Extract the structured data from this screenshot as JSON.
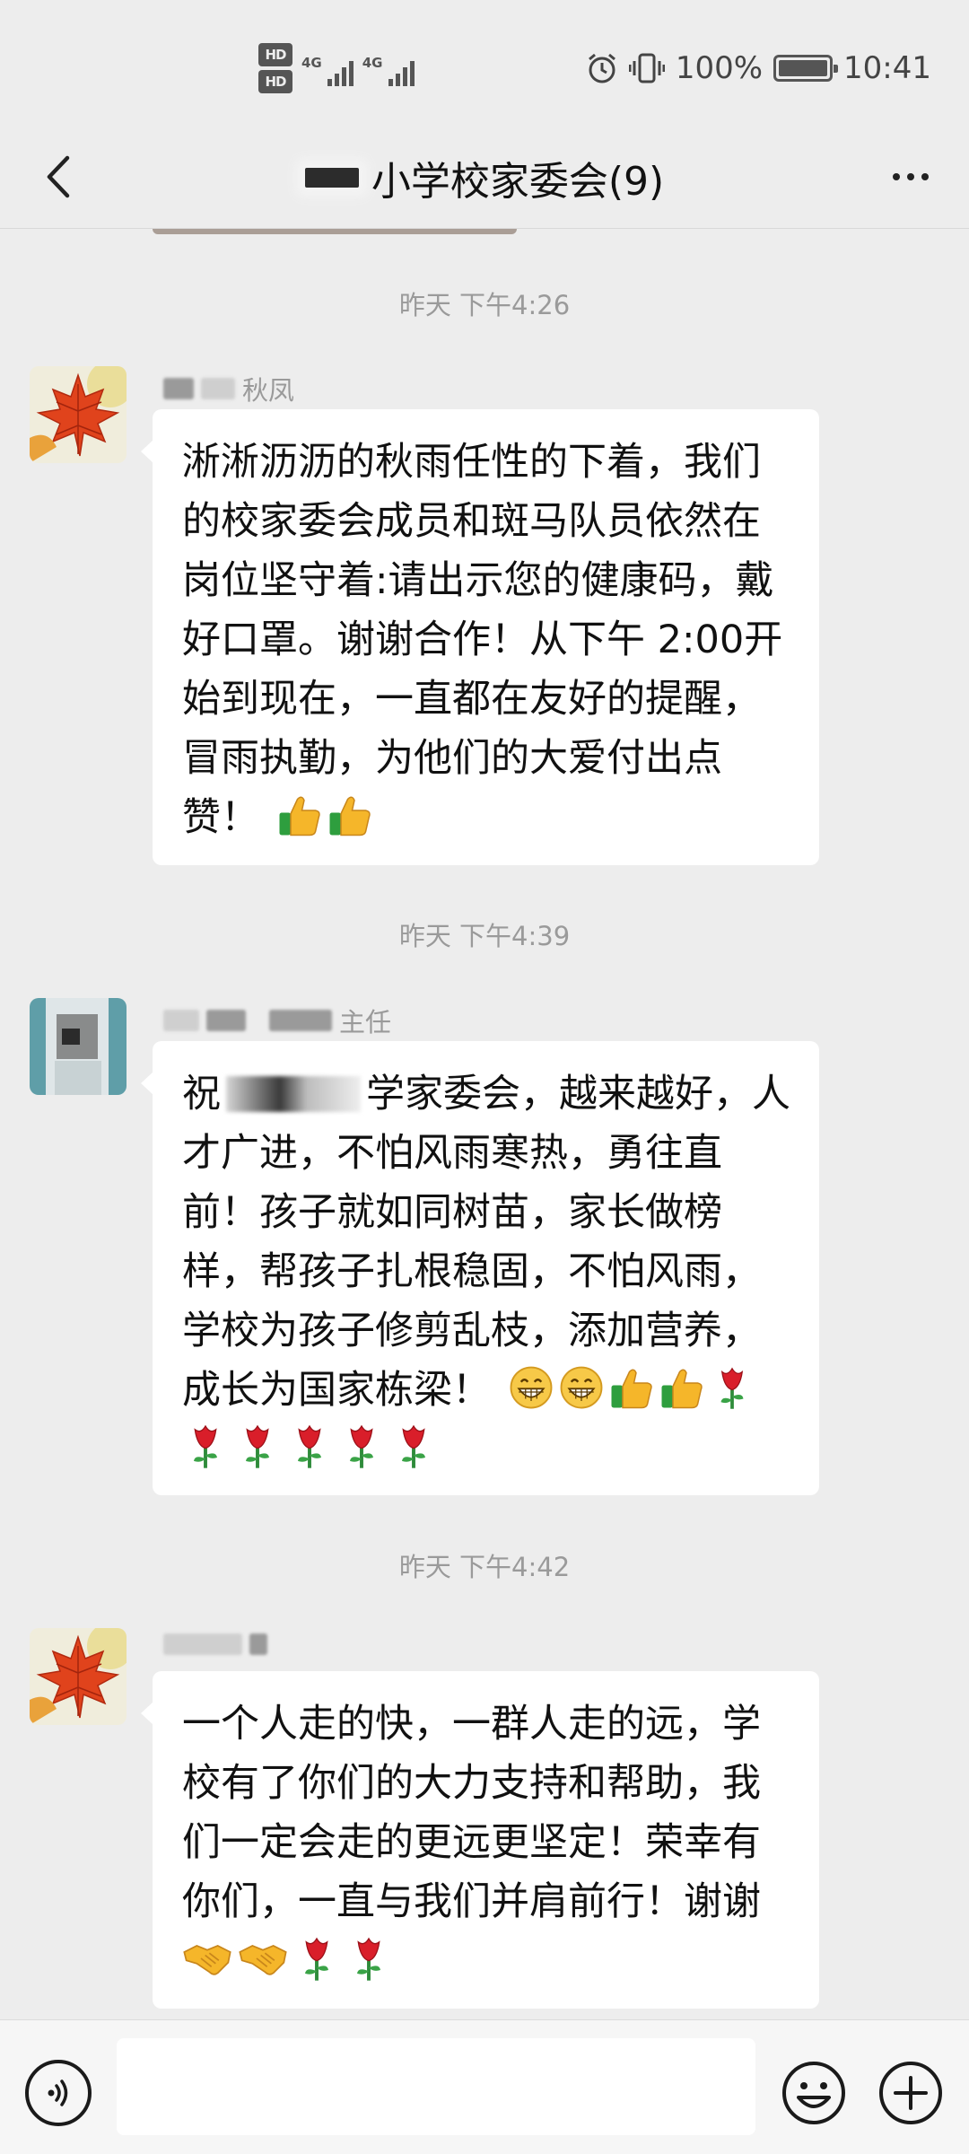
{
  "status_bar": {
    "hd1": "HD",
    "hd2": "HD",
    "net1": "4G",
    "net2": "4G",
    "battery_percent_text": "100%",
    "battery_level": 1.0,
    "time": "10:41",
    "icons": [
      "alarm-icon",
      "vibrate-icon",
      "battery-icon"
    ]
  },
  "header": {
    "title": "小学校家委会(9)",
    "back_icon": "chevron-left-icon",
    "more_icon": "more-icon"
  },
  "messages": [
    {
      "timestamp": "昨天 下午4:26",
      "sender_visible": "秋凤",
      "avatar": "maple-leaf-avatar",
      "text": "淅淅沥沥的秋雨任性的下着，我们的校家委会成员和斑马队员依然在岗位坚守着:请出示您的健康码，戴好口罩。谢谢合作！从下午 2:00开始到现在，一直都在友好的提醒，冒雨执勤，为他们的大爱付出点赞！",
      "emojis": [
        "thumbs-up",
        "thumbs-up"
      ]
    },
    {
      "timestamp": "昨天 下午4:39",
      "sender_visible": "主任",
      "avatar": "portrait-avatar",
      "text_prefix": "祝",
      "text": "学家委会，越来越好，人才广进，不怕风雨寒热，勇往直前！孩子就如同树苗，家长做榜样，帮孩子扎根稳固，不怕风雨，学校为孩子修剪乱枝，添加营养，成长为国家栋梁！",
      "emojis": [
        "grin",
        "grin",
        "thumbs-up",
        "thumbs-up",
        "rose",
        "rose",
        "rose",
        "rose",
        "rose",
        "rose"
      ]
    },
    {
      "timestamp": "昨天 下午4:42",
      "sender_visible": "",
      "avatar": "maple-leaf-avatar",
      "text": "一个人走的快，一群人走的远，学校有了你们的大力支持和帮助，我们一定会走的更远更坚定！荣幸有你们，一直与我们并肩前行！谢谢",
      "emojis": [
        "handshake",
        "handshake",
        "rose",
        "rose"
      ]
    }
  ],
  "input_bar": {
    "voice_icon": "voice-icon",
    "text_value": "",
    "emoji_icon": "emoji-icon",
    "add_icon": "plus-icon"
  },
  "colors": {
    "background": "#ededed",
    "bubble": "#ffffff",
    "timestamp": "#9a9a9a"
  }
}
